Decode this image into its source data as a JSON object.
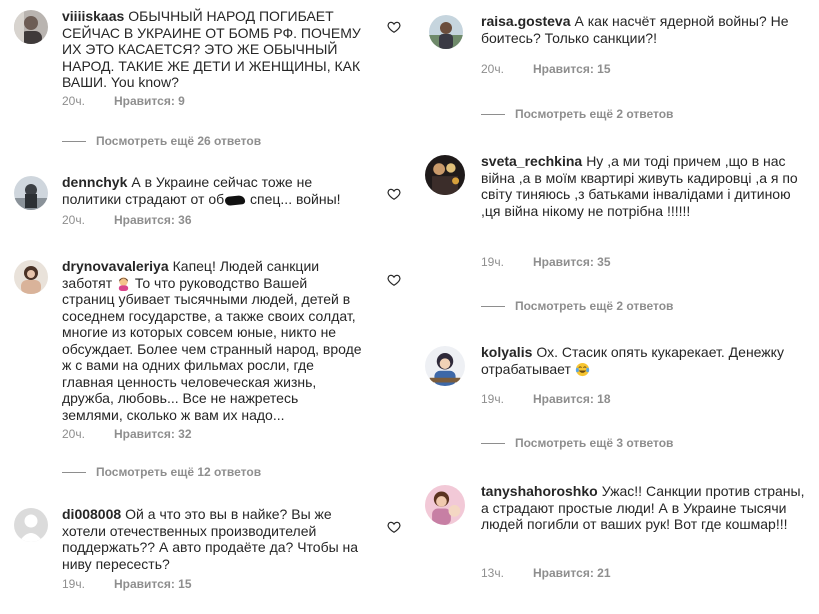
{
  "left_comments": [
    {
      "username": "viiiiskaas",
      "text": "ОБЫЧНЫЙ НАРОД ПОГИБАЕТ СЕЙЧАС В УКРАИНЕ ОТ БОМБ РФ. ПОЧЕМУ ИХ ЭТО КАСАЕТСЯ? ЭТО ЖЕ ОБЫЧНЫЙ НАРОД. ТАКИЕ ЖЕ ДЕТИ И ЖЕНЩИНЫ, КАК ВАШИ. You know?",
      "time": "20ч.",
      "likes": "Нравится: 9",
      "more_replies": "Посмотреть ещё 26 ответов"
    },
    {
      "username": "dennchyk",
      "text_before": "А в Украине сейчас тоже не политики страдают от об",
      "text_after": " спец... войны!",
      "time": "20ч.",
      "likes": "Нравится: 36"
    },
    {
      "username": "drynovavaleriya",
      "text_before": "Капец! Людей санкции заботят",
      "text_after": " То что руководство Вашей страниц убивает тысячными людей, детей в соседнем государстве, а также своих солдат, многие из которых совсем юные, никто не обсуждает. Более чем странный народ, вроде ж с вами на одних фильмах росли, где главная ценность человеческая жизнь, дружба, любовь... Все не нажретесь землями, сколько ж вам их надо...",
      "time": "20ч.",
      "likes": "Нравится: 32",
      "more_replies": "Посмотреть ещё 12 ответов"
    },
    {
      "username": "di008008",
      "text": "Ой а что это вы в найке? Вы же хотели отечественных производителей поддержать?? А авто продаёте да? Чтобы на ниву пересесть?",
      "time": "19ч.",
      "likes": "Нравится: 15"
    }
  ],
  "right_comments": [
    {
      "username": "raisa.gosteva",
      "text": "А как насчёт ядерной войны? Не боитесь? Только санкции?!",
      "time": "20ч.",
      "likes": "Нравится: 15",
      "more_replies": "Посмотреть ещё 2 ответов"
    },
    {
      "username": "sveta_rechkina",
      "text": "Ну ,а ми тоді причем ,що в нас війна ,а в моїм квартирі живуть кадировці ,а я по світу тиняюсь ,з батьками інвалідами і дитиною ,ця війна нікому не потрібна !!!!!!",
      "time": "19ч.",
      "likes": "Нравится: 35",
      "more_replies": "Посмотреть ещё 2 ответов"
    },
    {
      "username": "kolyalis",
      "text": "Ох. Стасик опять кукарекает. Денежку отрабатывает",
      "time": "19ч.",
      "likes": "Нравится: 18",
      "more_replies": "Посмотреть ещё 3 ответов"
    },
    {
      "username": "tanyshahoroshko",
      "text": "Ужас!! Санкции против страны, а страдают простые люди! А в Украине тысячи людей погибли от ваших рук! Вот где кошмар!!!",
      "time": "13ч.",
      "likes": "Нравится: 21"
    }
  ],
  "icons": {
    "like": "heart-outline-icon",
    "avatar_placeholder": "default-user-icon"
  },
  "colors": {
    "text": "#262626",
    "secondary": "#8e8e8e"
  }
}
